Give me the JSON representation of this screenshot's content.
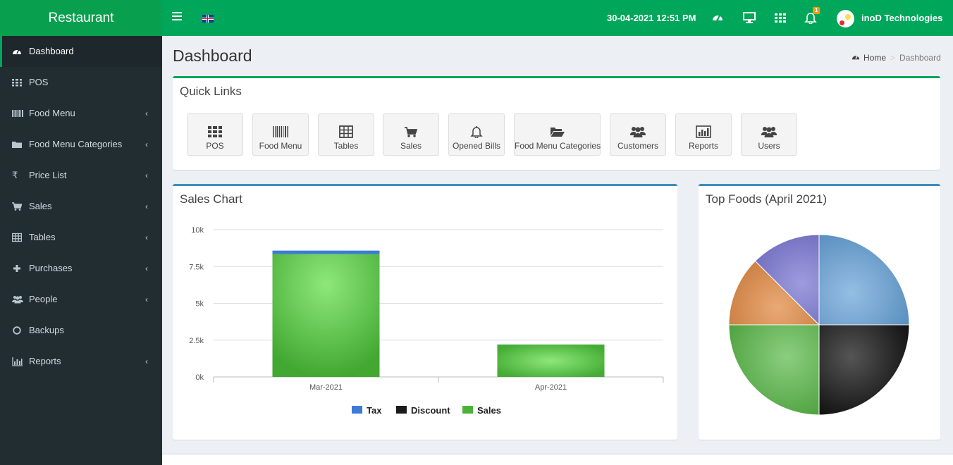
{
  "app": {
    "brand": "Restaurant"
  },
  "header": {
    "datetime": "30-04-2021 12:51 PM",
    "notification_count": "1",
    "user_name": "inoD Technologies",
    "icons": [
      "menu-toggle-icon",
      "uk-flag-icon",
      "dashboard-icon",
      "monitor-icon",
      "grid-icon",
      "bell-icon"
    ]
  },
  "sidebar": {
    "items": [
      {
        "label": "Dashboard",
        "icon": "dashboard-icon",
        "active": true,
        "has_children": false
      },
      {
        "label": "POS",
        "icon": "grid-icon",
        "has_children": false
      },
      {
        "label": "Food Menu",
        "icon": "barcode-icon",
        "has_children": true
      },
      {
        "label": "Food Menu Categories",
        "icon": "folder-icon",
        "has_children": true
      },
      {
        "label": "Price List",
        "icon": "rupee-icon",
        "has_children": true
      },
      {
        "label": "Sales",
        "icon": "cart-icon",
        "has_children": true
      },
      {
        "label": "Tables",
        "icon": "table-icon",
        "has_children": true
      },
      {
        "label": "Purchases",
        "icon": "plus-icon",
        "has_children": true
      },
      {
        "label": "People",
        "icon": "users-icon",
        "has_children": true
      },
      {
        "label": "Backups",
        "icon": "circle-icon",
        "has_children": false
      },
      {
        "label": "Reports",
        "icon": "bar-chart-icon",
        "has_children": true
      }
    ]
  },
  "main": {
    "title": "Dashboard",
    "breadcrumb": {
      "home": "Home",
      "current": "Dashboard"
    }
  },
  "quick_links": {
    "title": "Quick Links",
    "items": [
      {
        "label": "POS",
        "icon": "grid-icon"
      },
      {
        "label": "Food Menu",
        "icon": "barcode-icon"
      },
      {
        "label": "Tables",
        "icon": "table-icon"
      },
      {
        "label": "Sales",
        "icon": "cart-icon"
      },
      {
        "label": "Opened Bills",
        "icon": "bell-icon"
      },
      {
        "label": "Food Menu Categories",
        "icon": "folder-open-icon"
      },
      {
        "label": "Customers",
        "icon": "users-icon"
      },
      {
        "label": "Reports",
        "icon": "bar-chart-icon"
      },
      {
        "label": "Users",
        "icon": "users-icon"
      }
    ]
  },
  "sales_chart": {
    "title": "Sales Chart",
    "colors": {
      "tax": "#3c7bd6",
      "discount": "#1a1a1a",
      "sales": "#4cb33a",
      "border": "#3c8dbc"
    }
  },
  "top_foods": {
    "title": "Top Foods (April 2021)",
    "colors": {
      "border": "#3c8dbc"
    }
  },
  "chart_data": [
    {
      "type": "bar",
      "title": "Sales Chart",
      "stacked": true,
      "categories": [
        "Mar-2021",
        "Apr-2021"
      ],
      "y_tick_labels": [
        "0k",
        "2.5k",
        "5k",
        "7.5k",
        "10k"
      ],
      "ylim": [
        0,
        10000
      ],
      "legend": "bottom",
      "grid": true,
      "series": [
        {
          "name": "Sales",
          "values": [
            8350,
            2200
          ],
          "color": "#4cb33a"
        },
        {
          "name": "Discount",
          "values": [
            0,
            0
          ],
          "color": "#1a1a1a"
        },
        {
          "name": "Tax",
          "values": [
            230,
            0
          ],
          "color": "#3c7bd6"
        }
      ]
    },
    {
      "type": "pie",
      "title": "Top Foods (April 2021)",
      "labels": [],
      "slices": [
        {
          "value": 25,
          "color": "#5b9bd5"
        },
        {
          "value": 25,
          "color": "#1a1a1a"
        },
        {
          "value": 25,
          "color": "#4cb33a"
        },
        {
          "value": 12.5,
          "color": "#dd7a2c"
        },
        {
          "value": 12.5,
          "color": "#6a66cc"
        }
      ]
    }
  ]
}
